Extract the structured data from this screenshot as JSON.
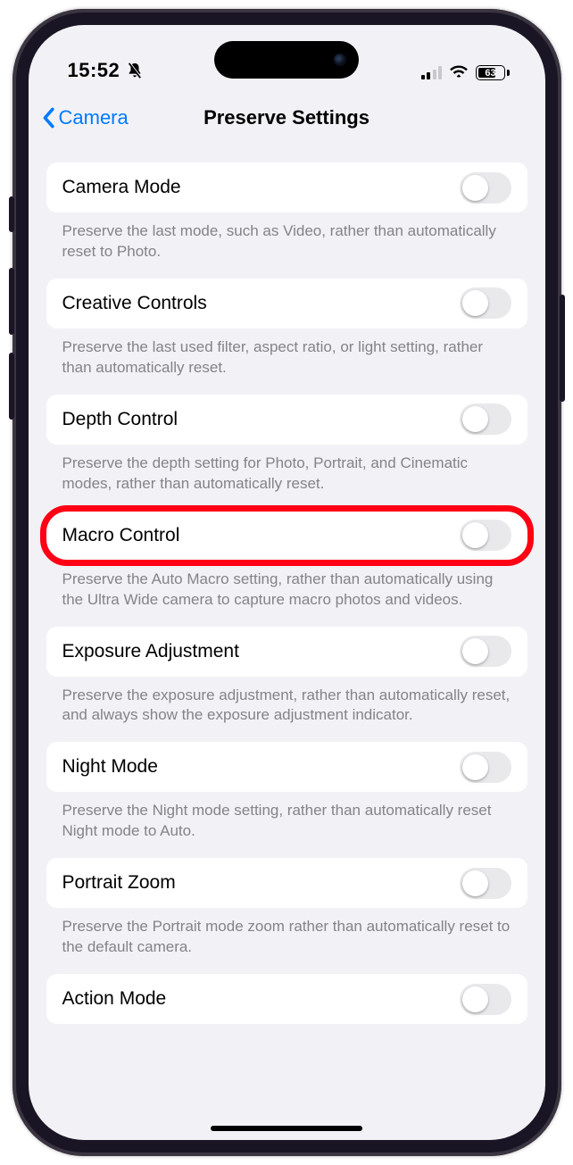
{
  "status": {
    "time": "15:52",
    "battery_pct": "63"
  },
  "nav": {
    "back": "Camera",
    "title": "Preserve Settings"
  },
  "rows": [
    {
      "label": "Camera Mode",
      "footer": "Preserve the last mode, such as Video, rather than automatically reset to Photo.",
      "highlight": false
    },
    {
      "label": "Creative Controls",
      "footer": "Preserve the last used filter, aspect ratio, or light setting, rather than automatically reset.",
      "highlight": false
    },
    {
      "label": "Depth Control",
      "footer": "Preserve the depth setting for Photo, Portrait, and Cinematic modes, rather than automatically reset.",
      "highlight": false
    },
    {
      "label": "Macro Control",
      "footer": "Preserve the Auto Macro setting, rather than automatically using the Ultra Wide camera to capture macro photos and videos.",
      "highlight": true
    },
    {
      "label": "Exposure Adjustment",
      "footer": "Preserve the exposure adjustment, rather than automatically reset, and always show the exposure adjustment indicator.",
      "highlight": false
    },
    {
      "label": "Night Mode",
      "footer": "Preserve the Night mode setting, rather than automatically reset Night mode to Auto.",
      "highlight": false
    },
    {
      "label": "Portrait Zoom",
      "footer": "Preserve the Portrait mode zoom rather than automatically reset to the default camera.",
      "highlight": false
    },
    {
      "label": "Action Mode",
      "footer": "",
      "highlight": false
    }
  ]
}
